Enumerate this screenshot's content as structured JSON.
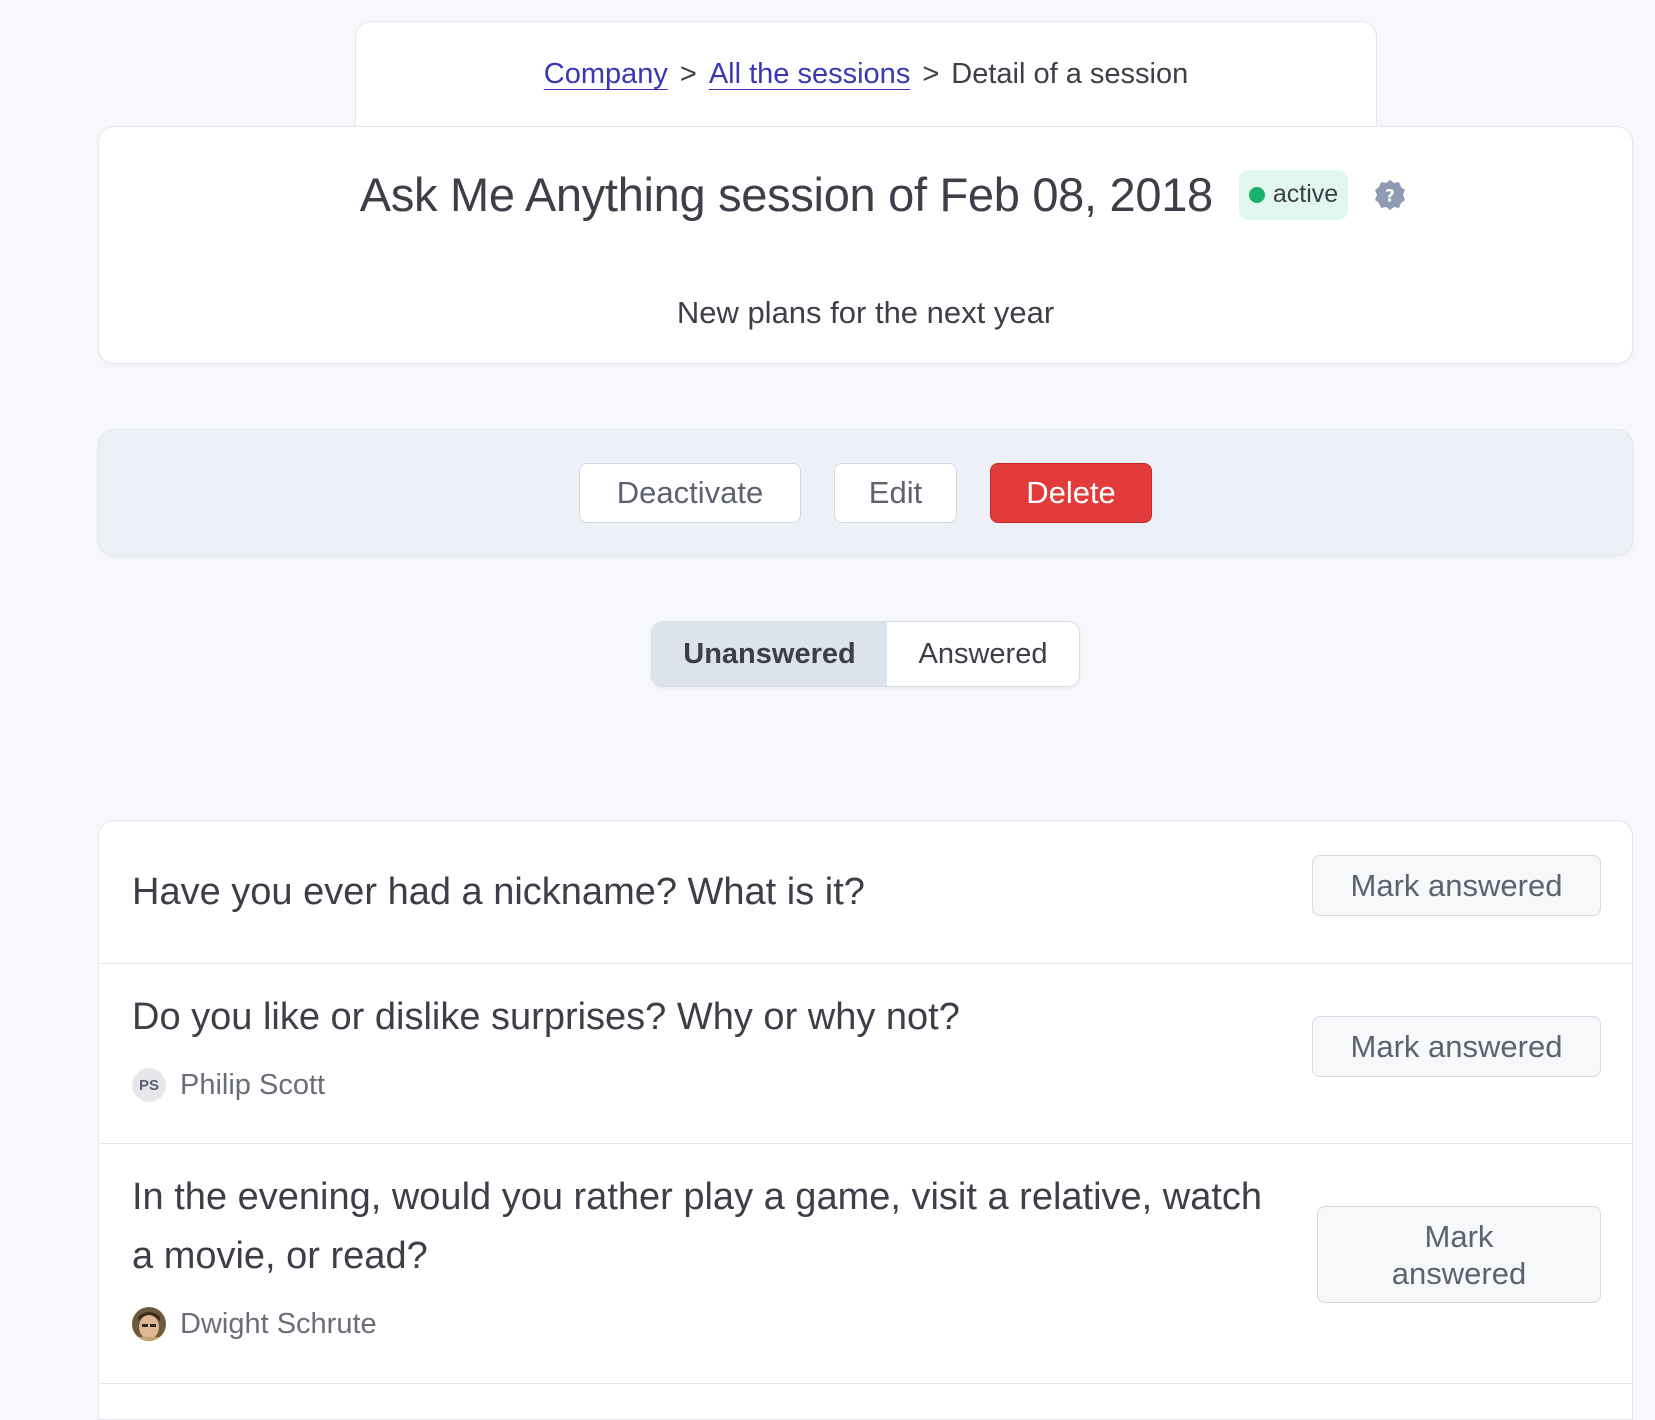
{
  "breadcrumb": {
    "items": [
      {
        "label": "Company"
      },
      {
        "label": "All the sessions"
      },
      {
        "label": "Detail of a session"
      }
    ],
    "separator": ">"
  },
  "session": {
    "title": "Ask Me Anything session of Feb 08, 2018",
    "status": "active",
    "status_color": "#1ab26b",
    "help_icon": "question-badge-icon",
    "subtitle": "New plans for the next year"
  },
  "actions": {
    "deactivate_label": "Deactivate",
    "edit_label": "Edit",
    "delete_label": "Delete",
    "delete_color": "#e23b3b"
  },
  "tabs": [
    {
      "label": "Unanswered",
      "active": true
    },
    {
      "label": "Answered",
      "active": false
    }
  ],
  "questions": [
    {
      "text": "Have you ever had a nickname? What is it?",
      "author": "",
      "action_label": "Mark answered"
    },
    {
      "text": "Do you like or dislike surprises? Why or why not?",
      "author": "Philip Scott",
      "author_initials": "PS",
      "action_label": "Mark answered"
    },
    {
      "text_line1": "In the evening, would you rather play a game, visit a relative, watch",
      "text_line2": "a movie, or read?",
      "author": "Dwight Schrute",
      "action_label_line1": "Mark",
      "action_label_line2": "answered"
    }
  ]
}
